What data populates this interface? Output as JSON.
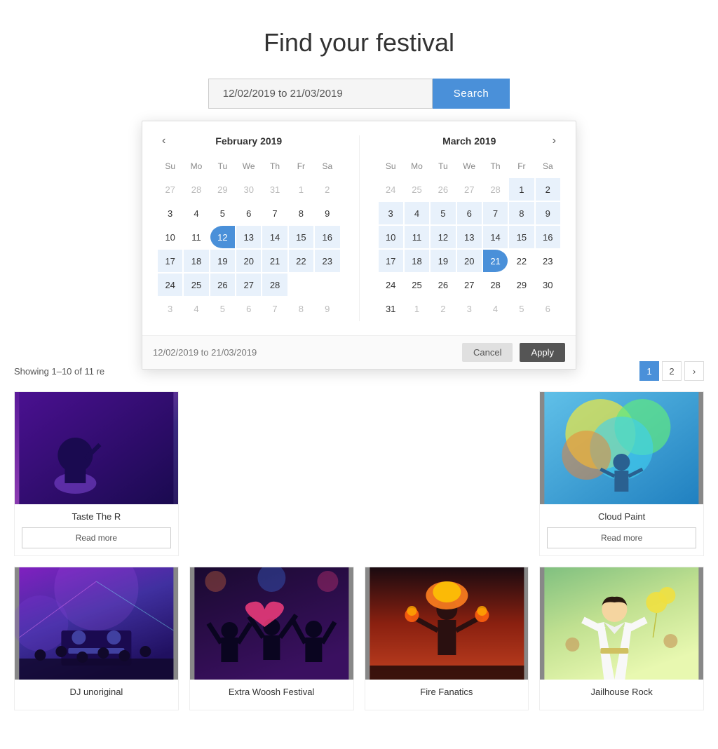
{
  "page": {
    "title": "Find your festival"
  },
  "search": {
    "date_range_value": "12/02/2019 to 21/03/2019",
    "placeholder": "12/02/2019 to 21/03/2019",
    "button_label": "Search"
  },
  "results": {
    "count_text": "Showing 1–10 of 11 re"
  },
  "calendar": {
    "left_month": "February 2019",
    "right_month": "March 2019",
    "footer_date_range": "12/02/2019 to 21/03/2019",
    "cancel_label": "Cancel",
    "apply_label": "Apply",
    "days_of_week": [
      "Su",
      "Mo",
      "Tu",
      "We",
      "Th",
      "Fr",
      "Sa"
    ],
    "feb_weeks": [
      [
        "27",
        "28",
        "29",
        "30",
        "31",
        "1",
        "2"
      ],
      [
        "3",
        "4",
        "5",
        "6",
        "7",
        "8",
        "9"
      ],
      [
        "10",
        "11",
        "12",
        "13",
        "14",
        "15",
        "16"
      ],
      [
        "17",
        "18",
        "19",
        "20",
        "21",
        "22",
        "23"
      ],
      [
        "24",
        "25",
        "26",
        "27",
        "28",
        "",
        ""
      ],
      [
        "3",
        "4",
        "5",
        "6",
        "7",
        "8",
        "9"
      ]
    ],
    "mar_weeks": [
      [
        "24",
        "25",
        "26",
        "27",
        "28",
        "1",
        "2"
      ],
      [
        "3",
        "4",
        "5",
        "6",
        "7",
        "8",
        "9"
      ],
      [
        "10",
        "11",
        "12",
        "13",
        "14",
        "15",
        "16"
      ],
      [
        "17",
        "18",
        "19",
        "20",
        "21",
        "22",
        "23"
      ],
      [
        "24",
        "25",
        "26",
        "27",
        "28",
        "29",
        "30"
      ],
      [
        "31",
        "1",
        "2",
        "3",
        "4",
        "5",
        "6"
      ]
    ]
  },
  "pagination": {
    "pages": [
      "1",
      "2"
    ],
    "next_label": "›"
  },
  "top_cards": [
    {
      "title": "Taste The R",
      "read_more": "Read more",
      "img_class": "card-img-concert1"
    },
    {
      "title": "",
      "read_more": "",
      "img_class": ""
    },
    {
      "title": "",
      "read_more": "",
      "img_class": ""
    },
    {
      "title": "Cloud Paint",
      "read_more": "Read more",
      "img_class": "card-img-concert2"
    }
  ],
  "bottom_cards": [
    {
      "title": "DJ unoriginal",
      "img_class": "card-img-concert3"
    },
    {
      "title": "Extra Woosh Festival",
      "img_class": "card-img-concert4"
    },
    {
      "title": "Fire Fanatics",
      "img_class": "card-img-concert5"
    },
    {
      "title": "Jailhouse Rock",
      "img_class": "card-img-elvis"
    }
  ]
}
